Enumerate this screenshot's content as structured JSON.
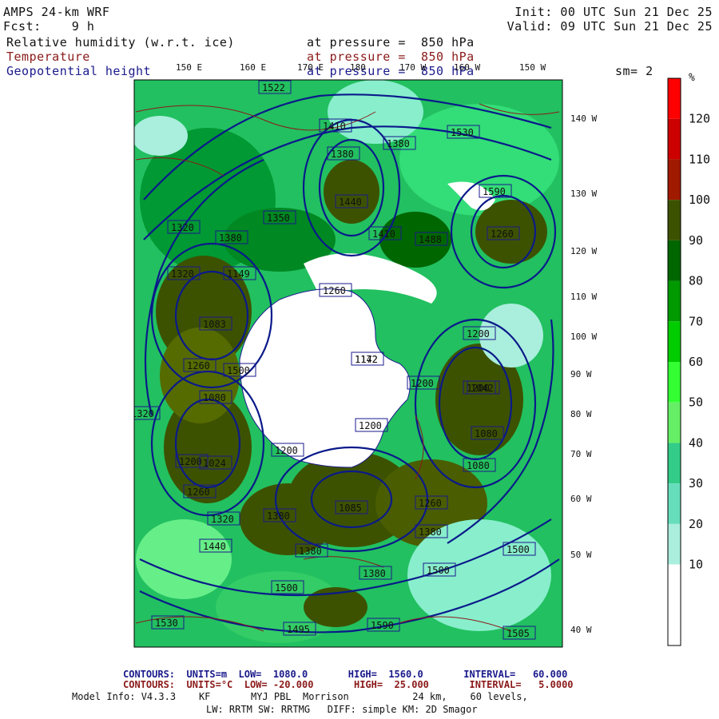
{
  "header": {
    "model": "AMPS 24-km WRF",
    "fcst": "Fcst:    9 h",
    "init": "Init: 00 UTC Sun 21 Dec 25",
    "valid": "Valid: 09 UTC Sun 21 Dec 25",
    "fields": [
      {
        "name": "Relative humidity (w.r.t. ice)",
        "level": "at pressure =  850 hPa",
        "color": "#111111"
      },
      {
        "name": "Temperature",
        "level": "at pressure =  850 hPa",
        "color": "#8b1a1a"
      },
      {
        "name": "Geopotential height",
        "level": "at pressure =  850 hPa",
        "color": "#1a1a8c"
      }
    ],
    "smoothing": "sm= 2"
  },
  "top_lon_labels": [
    "150 E",
    "160 E",
    "170 E",
    "180",
    "170 W",
    "160 W",
    "150 W"
  ],
  "right_lon_labels": [
    "140 W",
    "130 W",
    "120 W",
    "110 W",
    "100 W",
    "90 W",
    "80 W",
    "70 W",
    "60 W",
    "50 W",
    "40 W"
  ],
  "colorbar": {
    "unit": "%",
    "labels": [
      "120",
      "110",
      "100",
      "90",
      "80",
      "70",
      "60",
      "50",
      "40",
      "30",
      "20",
      "10"
    ],
    "colors": [
      "#ff0000",
      "#cc0000",
      "#a01a00",
      "#3d5200",
      "#006600",
      "#009900",
      "#00cc00",
      "#33ff33",
      "#66ee66",
      "#33cc88",
      "#66ddbb",
      "#aaeedd",
      "#ffffff",
      "#ffffff"
    ]
  },
  "height_labels": [
    "1522",
    "1410",
    "1380",
    "1380",
    "1530",
    "1590",
    "1440",
    "1410",
    "1488",
    "1320",
    "1380",
    "1350",
    "1320",
    "1149",
    "1260",
    "1083",
    "1200",
    "1142",
    "1500",
    "1172",
    "1260",
    "1200",
    "1042",
    "1200",
    "1080",
    "1320",
    "1200",
    "1080",
    "1200",
    "1200",
    "1260",
    "1024",
    "1085",
    "1320",
    "1380",
    "1260",
    "1440",
    "1380",
    "1380",
    "1500",
    "1500",
    "1380",
    "1500",
    "1530",
    "1495",
    "1505",
    "1590",
    "1260",
    "1080"
  ],
  "footer": {
    "geo_line": "CONTOURS:  UNITS=m  LOW=  1080.0       HIGH=  1560.0       INTERVAL=   60.000",
    "temp_line": "CONTOURS:  UNITS=°C  LOW= -20.000       HIGH=  25.000       INTERVAL=   5.0000",
    "model_info": "Model Info: V4.3.3    KF       MYJ PBL  Morrison           24 km,    60 levels,",
    "physics": "LW: RRTM SW: RRTMG   DIFF: simple KM: 2D Smagor"
  }
}
